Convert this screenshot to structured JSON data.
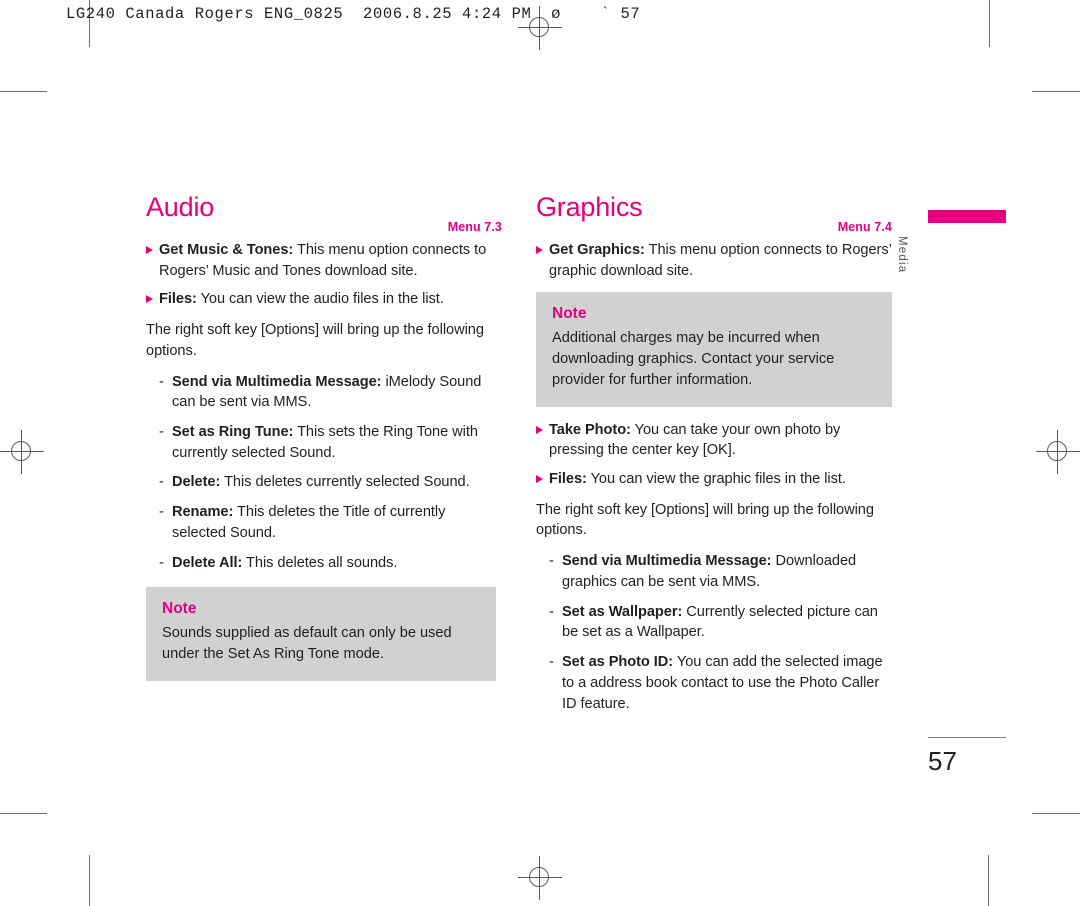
{
  "slug": {
    "text": "LG240 Canada Rogers ENG_0825  2006.8.25 4:24 PM  ø    ` 57"
  },
  "colors": {
    "accent": "#e6007e",
    "note_bg": "#d1d1d1",
    "text": "#231f20",
    "mark": "#58595b"
  },
  "side_tab": {
    "label": "Media"
  },
  "folio": {
    "page_number": "57"
  },
  "left_column": {
    "title": "Audio",
    "menu_ref": "Menu 7.3",
    "bullets": [
      {
        "term": "Get Music & Tones:",
        "text": " This menu option connects to Rogers’ Music and Tones download site."
      },
      {
        "term": "Files:",
        "text": " You can view the audio files in the list."
      }
    ],
    "intro": "The right soft key [Options] will bring up the following options.",
    "options": [
      {
        "dash": "-",
        "term": "Send via Multimedia Message:",
        "text": " iMelody Sound can be sent via MMS."
      },
      {
        "dash": "-",
        "term": "Set as Ring Tune:",
        "text": " This sets the Ring Tone with currently selected Sound."
      },
      {
        "dash": "-",
        "term": "Delete:",
        "text": " This deletes currently selected Sound."
      },
      {
        "dash": "-",
        "term": "Rename:",
        "text": " This deletes the Title of currently selected Sound."
      },
      {
        "dash": "-",
        "term": "Delete All:",
        "text": " This deletes all sounds."
      }
    ],
    "note": {
      "title": "Note",
      "body": "Sounds supplied as default can only be used under the Set As Ring Tone mode."
    }
  },
  "right_column": {
    "title": "Graphics",
    "menu_ref": "Menu 7.4",
    "bullets_top": [
      {
        "term": "Get Graphics:",
        "text": " This menu option connects to Rogers’ graphic download site."
      }
    ],
    "note": {
      "title": "Note",
      "body": "Additional charges may be incurred when downloading graphics. Contact your service provider for further information."
    },
    "bullets_bottom": [
      {
        "term": "Take Photo:",
        "text": " You can take your own photo by pressing the center key [OK]."
      },
      {
        "term": "Files:",
        "text": " You can view the graphic files in the list."
      }
    ],
    "intro": "The right soft key [Options] will bring up the following options.",
    "options": [
      {
        "dash": "-",
        "term": "Send via Multimedia Message:",
        "text": " Downloaded graphics can be sent via MMS."
      },
      {
        "dash": "-",
        "term": "Set as Wallpaper:",
        "text": " Currently selected picture can be set as a Wallpaper."
      },
      {
        "dash": "-",
        "term": "Set as Photo ID:",
        "text": " You can add the selected image to a address book contact to use the Photo Caller ID feature."
      }
    ]
  }
}
